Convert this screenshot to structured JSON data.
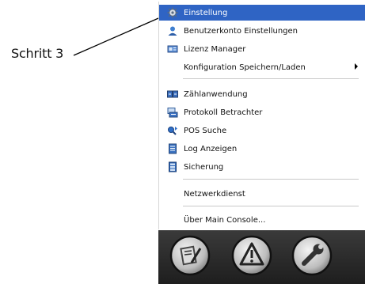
{
  "annotation": {
    "label": "Schritt 3"
  },
  "menu": {
    "items": [
      {
        "label": "Einstellung",
        "icon": "gear-icon",
        "selected": true
      },
      {
        "label": "Benutzerkonto Einstellungen",
        "icon": "user-icon"
      },
      {
        "label": "Lizenz Manager",
        "icon": "license-card-icon"
      },
      {
        "label": "Konfiguration Speichern/Laden",
        "icon": "",
        "submenu": true
      },
      {
        "label": "Zählanwendung",
        "icon": "counter-icon"
      },
      {
        "label": "Protokoll Betrachter",
        "icon": "protocol-viewer-icon"
      },
      {
        "label": "POS Suche",
        "icon": "pos-search-icon"
      },
      {
        "label": "Log Anzeigen",
        "icon": "log-icon"
      },
      {
        "label": "Sicherung",
        "icon": "backup-icon"
      },
      {
        "label": "Netzwerkdienst",
        "icon": ""
      },
      {
        "label": "Über Main Console...",
        "icon": ""
      }
    ]
  },
  "toolbar": {
    "buttons": [
      {
        "icon": "edit-document-icon"
      },
      {
        "icon": "warning-icon"
      },
      {
        "icon": "wrench-icon"
      }
    ]
  },
  "colors": {
    "selected_bg": "#2f64c4",
    "toolbar_bg": "#262626"
  }
}
